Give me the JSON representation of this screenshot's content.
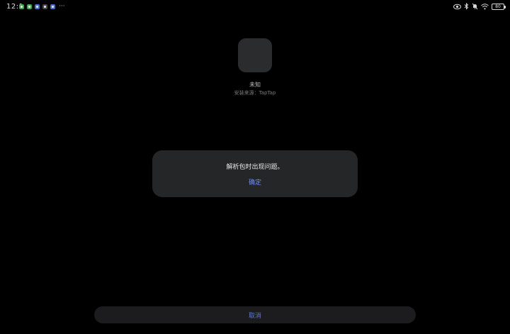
{
  "status_bar": {
    "time": "12:1",
    "notification_icons": [
      {
        "name": "wechat-icon",
        "color": "#3fa64a"
      },
      {
        "name": "wechat-icon",
        "color": "#3fa64a"
      },
      {
        "name": "app-icon",
        "color": "#3f6fd1"
      },
      {
        "name": "app-icon",
        "color": "#4a4a4a"
      },
      {
        "name": "app-icon",
        "color": "#3f6fd1"
      }
    ],
    "more": "···",
    "battery": "80"
  },
  "app": {
    "name": "未知",
    "source": "安装来源：TapTap"
  },
  "dialog": {
    "message": "解析包时出现问题。",
    "confirm_label": "确定"
  },
  "footer": {
    "cancel_label": "取消"
  },
  "colors": {
    "accent": "#6f8dff",
    "dialog_bg": "#252628",
    "background": "#000000"
  }
}
